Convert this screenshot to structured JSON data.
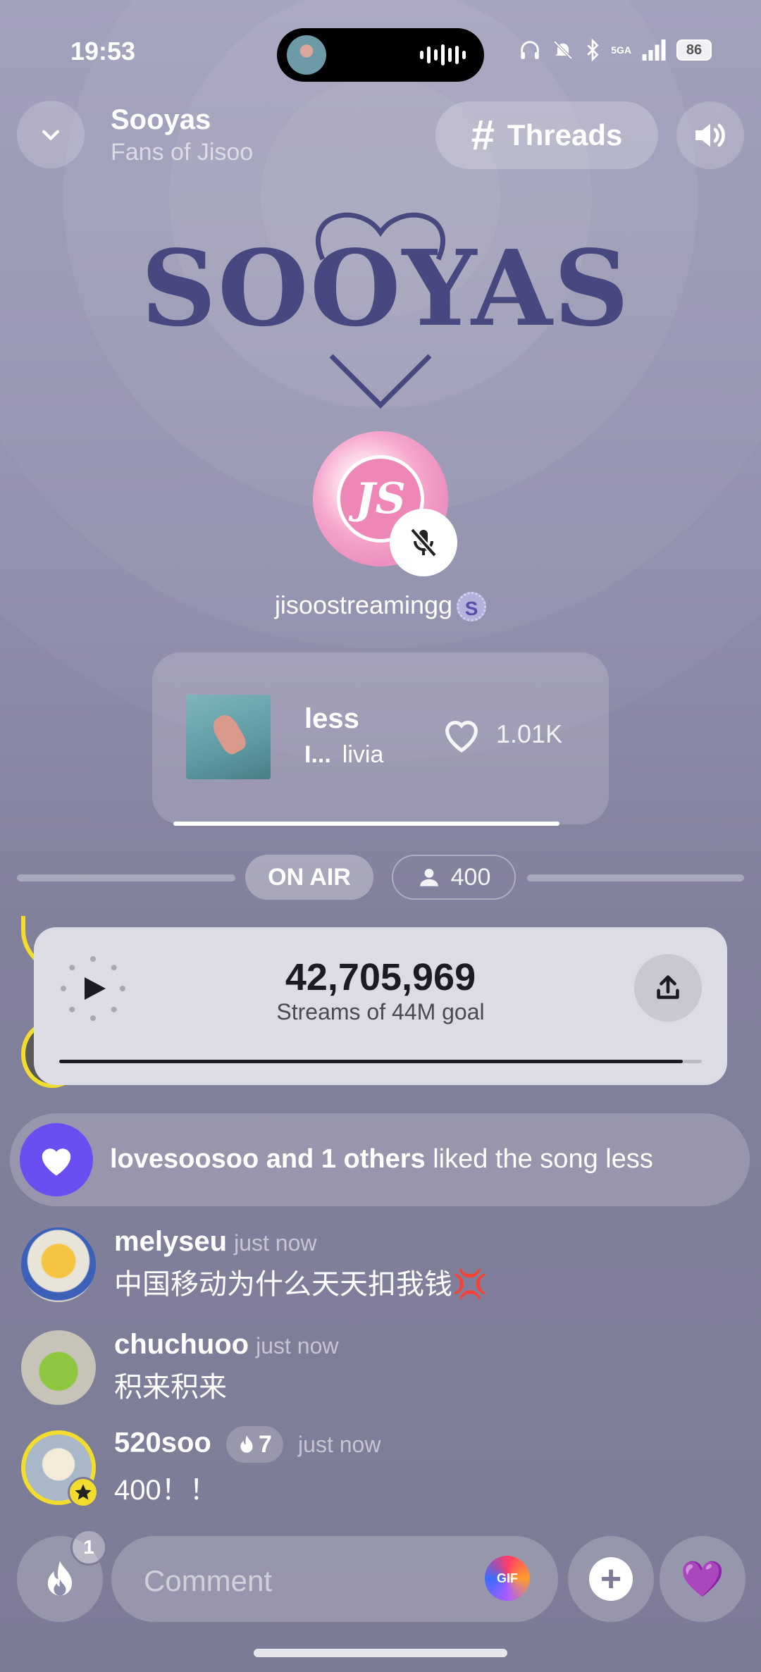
{
  "status_bar": {
    "time": "19:53",
    "signal": "5GA",
    "battery": "86"
  },
  "header": {
    "title": "Sooyas",
    "subtitle": "Fans of Jisoo",
    "threads_label": "Threads"
  },
  "logo": {
    "text": "SOOYAS"
  },
  "host": {
    "name": "jisoostreamingg",
    "badge": "S",
    "avatar_text": "JS"
  },
  "now_playing": {
    "title": "less",
    "artist": "livia",
    "likes": "1.01K",
    "equalizer": "I..."
  },
  "live": {
    "status": "ON AIR",
    "listeners": "400"
  },
  "streams": {
    "count": "42,705,969",
    "label": "Streams of 44M goal",
    "progress": 0.97
  },
  "like_banner": {
    "users": "lovesoosoo and 1 others",
    "rest": " liked the song less"
  },
  "messages": [
    {
      "user": "melyseu",
      "time": "just now",
      "text": "中国移动为什么天天扣我钱",
      "emoji": "💢"
    },
    {
      "user": "chuchuoo",
      "time": "just now",
      "text": "积来积来"
    },
    {
      "user": "520soo",
      "fire": "7",
      "time": "just now",
      "text": "400！！"
    }
  ],
  "composer": {
    "fire_count": "1",
    "placeholder": "Comment",
    "gif_label": "GIF",
    "plus": "+",
    "heart": "💜"
  },
  "colors": {
    "accent": "#6b4ef2",
    "logo": "#46487f",
    "badge": "#f2dc2e"
  }
}
